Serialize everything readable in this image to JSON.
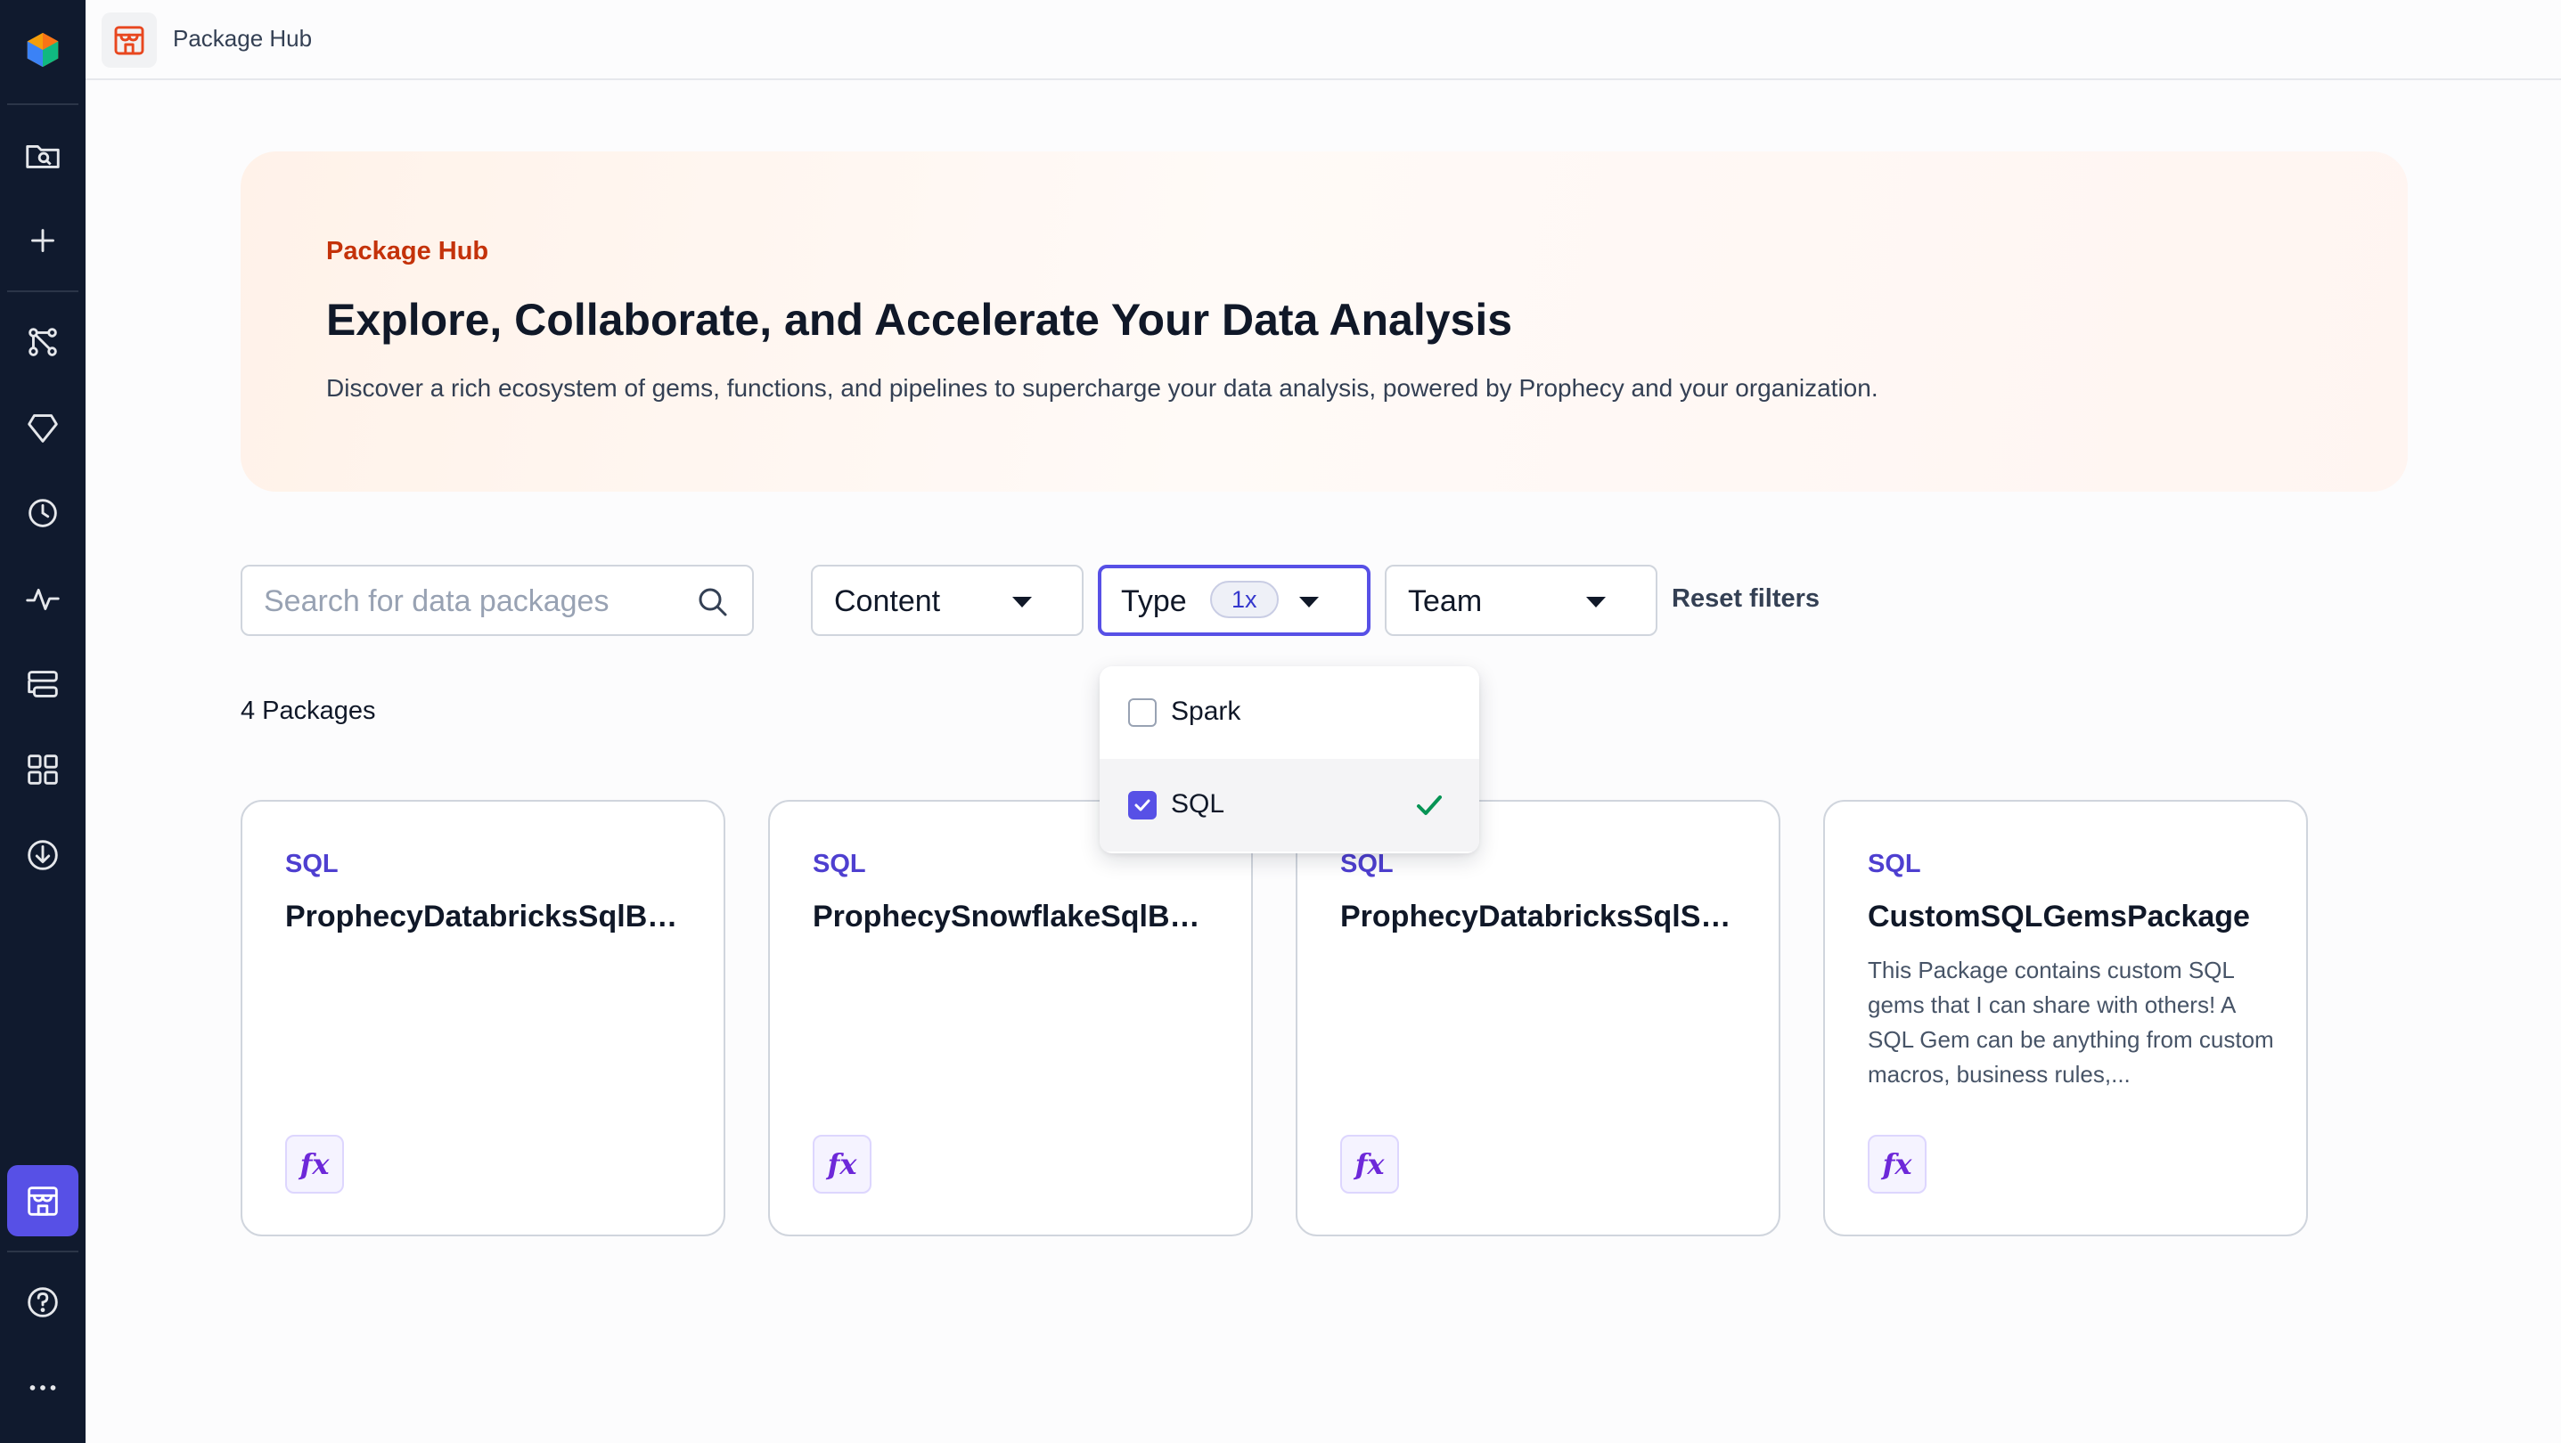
{
  "topbar": {
    "title": "Package Hub"
  },
  "hero": {
    "eyebrow": "Package Hub",
    "headline": "Explore, Collaborate, and Accelerate Your Data Analysis",
    "subtitle": "Discover a rich ecosystem of gems, functions, and pipelines to supercharge your data analysis, powered by Prophecy and your organization."
  },
  "filters": {
    "search_placeholder": "Search for data packages",
    "content_label": "Content",
    "type_label": "Type",
    "type_count": "1x",
    "team_label": "Team",
    "reset_label": "Reset filters"
  },
  "type_options": [
    {
      "label": "Spark",
      "checked": false
    },
    {
      "label": "SQL",
      "checked": true
    }
  ],
  "package_count": "4 Packages",
  "packages": [
    {
      "tag": "SQL",
      "name": "ProphecyDatabricksSqlBa...",
      "description": "",
      "icon": "fx"
    },
    {
      "tag": "SQL",
      "name": "ProphecySnowflakeSqlBas...",
      "description": "",
      "icon": "fx"
    },
    {
      "tag": "SQL",
      "name": "ProphecyDatabricksSqlSp...",
      "description": "",
      "icon": "fx"
    },
    {
      "tag": "SQL",
      "name": "CustomSQLGemsPackage",
      "description": "This Package contains custom SQL gems that I can share with others! A SQL Gem can be anything from custom macros, business rules,...",
      "icon": "fx"
    }
  ],
  "colors": {
    "sidebar_bg": "#101a2e",
    "accent": "#5750e6",
    "eyebrow": "#c4320a",
    "tag": "#4e3fd0",
    "check": "#079455"
  },
  "sidebar_icons": [
    "logo-icon",
    "browse-projects-icon",
    "create-icon",
    "pipelines-icon",
    "gems-icon",
    "history-icon",
    "monitoring-icon",
    "deployments-icon",
    "apps-icon",
    "download-icon",
    "package-hub-icon",
    "help-icon",
    "more-icon"
  ]
}
